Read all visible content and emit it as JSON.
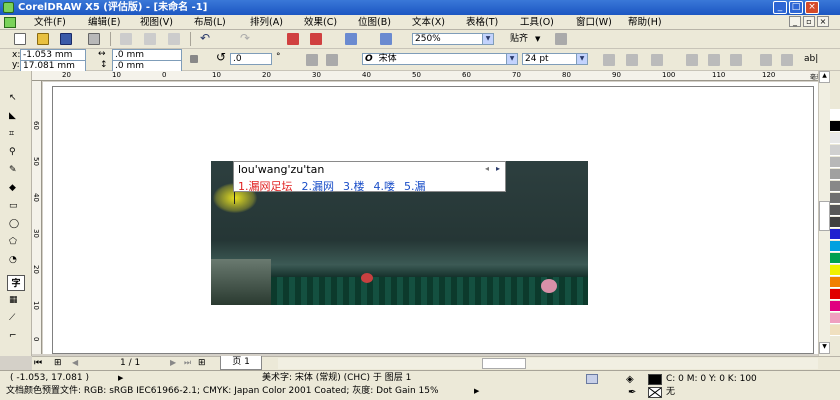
{
  "window": {
    "title": "CorelDRAW X5 (评估版) - [未命名 -1]"
  },
  "menu": [
    "文件(F)",
    "编辑(E)",
    "视图(V)",
    "布局(L)",
    "排列(A)",
    "效果(C)",
    "位图(B)",
    "文本(X)",
    "表格(T)",
    "工具(O)",
    "窗口(W)",
    "帮助(H)"
  ],
  "toolbar": {
    "zoom": "250%",
    "snap_label": "贴齐"
  },
  "propbar": {
    "x": "-1.053 mm",
    "y": "17.081 mm",
    "width": ".0 mm",
    "height": ".0 mm",
    "angle": ".0",
    "angle_unit": "°",
    "font_name": "宋体",
    "font_size": "24 pt",
    "small_label": "ab|"
  },
  "rulers": {
    "h_ticks": [
      "20",
      "10",
      "0",
      "10",
      "20",
      "30",
      "40",
      "50",
      "60",
      "70",
      "80",
      "90",
      "100",
      "110",
      "120"
    ],
    "h_unit": "毫米",
    "v_ticks": [
      "60",
      "50",
      "40",
      "30",
      "20",
      "10",
      "0"
    ]
  },
  "ime": {
    "composition": "lou'wang'zu'tan",
    "candidates": [
      "1.漏网足坛",
      "2.漏网",
      "3.楼",
      "4.喽",
      "5.漏"
    ]
  },
  "pager": {
    "page_count": "1 / 1",
    "page_tab": "页 1"
  },
  "status": {
    "coords": "( -1.053, 17.081 )",
    "object_info": "美术字: 宋体 (常规) (CHC) 于 图层 1",
    "color_profile": "文档颜色预置文件: RGB: sRGB IEC61966-2.1; CMYK: Japan Color 2001 Coated; 灰度: Dot Gain 15%",
    "fill_values": "C: 0 M: 0 Y: 0 K: 100",
    "outline_label": "无"
  },
  "palette": [
    "#ffffff",
    "#000000",
    "#e8e8e8",
    "#d0d0d0",
    "#b8b8b8",
    "#a0a0a0",
    "#888888",
    "#707070",
    "#585858",
    "#404040",
    "#1f1fd0",
    "#00a0e0",
    "#00a050",
    "#f0f000",
    "#f08000",
    "#e00000",
    "#e00080",
    "#f0a0c0",
    "#f0e0c0"
  ]
}
